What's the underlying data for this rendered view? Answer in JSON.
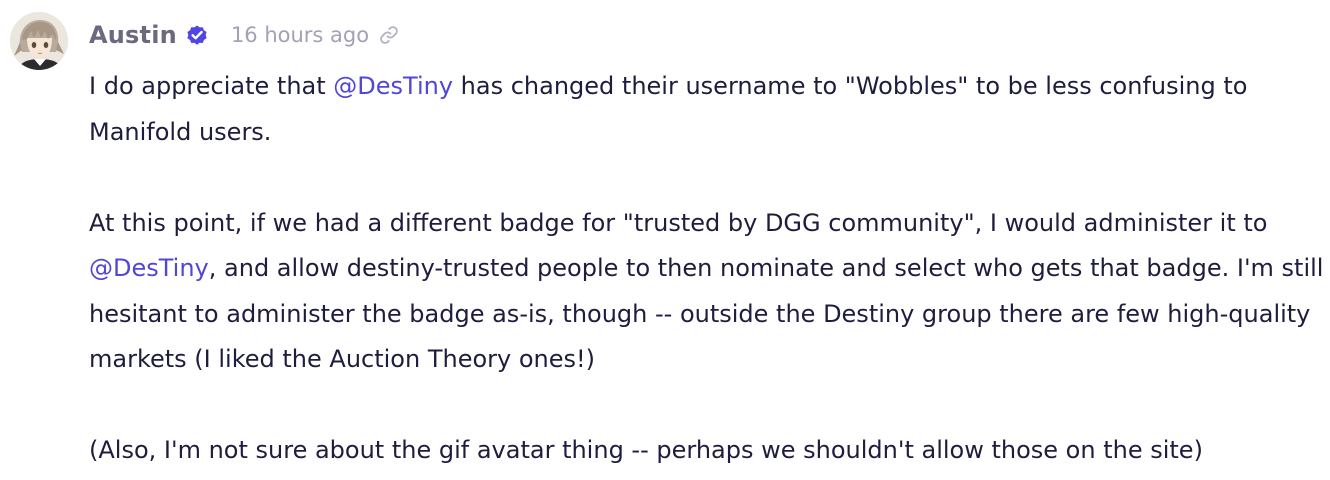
{
  "comment": {
    "author": {
      "name": "Austin",
      "verified_icon": "verified-badge-icon",
      "avatar_icon": "avatar-anime-character"
    },
    "timestamp": "16 hours ago",
    "link_icon": "link-icon",
    "paragraphs": [
      {
        "p1_a": "I do appreciate that ",
        "p1_mention": "@DesTiny",
        "p1_b": " has changed their username to \"Wobbles\" to be less confusing to Manifold users."
      },
      {
        "p2_a": "At this point, if we had a different badge for \"trusted by DGG community\", I would administer it to ",
        "p2_mention": "@DesTiny",
        "p2_b": ", and allow destiny-trusted people to then nominate and select who gets that badge. I'm still hesitant to administer the badge as-is, though -- outside the Destiny group there are few high-quality markets (I liked the Auction Theory ones!)"
      },
      {
        "p3": "(Also, I'm not sure about the gif avatar thing -- perhaps we shouldn't allow those on the site)"
      }
    ],
    "colors": {
      "mention": "#5146d8",
      "verified": "#4f46e5",
      "text": "#1f1d3d",
      "muted": "#a4a1b6"
    }
  }
}
